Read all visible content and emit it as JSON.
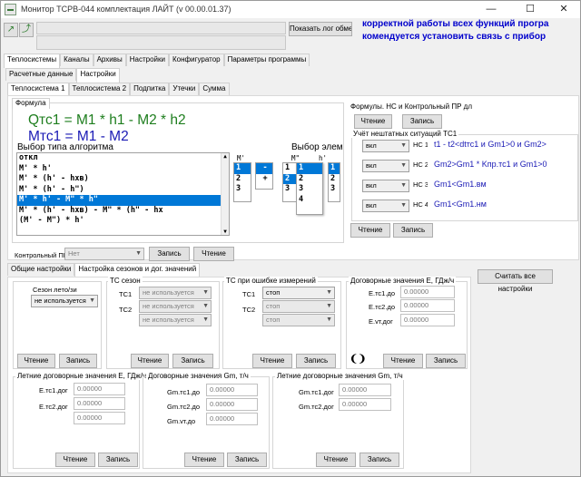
{
  "window": {
    "title": "Монитор ТСРВ-044 комплектация ЛАЙТ (v 00.00.01.37)",
    "minimize": "—",
    "maximize": "☐",
    "close": "✕"
  },
  "toolbar": {
    "show_log_label": "Показать лог обмена",
    "warning_line1": "корректной работы всех функций програ",
    "warning_line2": "комендуется установить связь с прибор"
  },
  "main_tabs": [
    "Теплосистемы",
    "Каналы",
    "Архивы",
    "Настройки",
    "Конфигуратор",
    "Параметры программы"
  ],
  "sub_tabs": [
    "Расчетные данные",
    "Настройки"
  ],
  "system_tabs": [
    "Теплосистема 1",
    "Теплосистема 2",
    "Подпитка",
    "Утечки",
    "Сумма"
  ],
  "formula": {
    "group_label": "Формула",
    "q_formula": "Qтс1 = M1 * h1 - M2 * h2",
    "m_formula": "Мтс1 = M1 - M2",
    "algo_label": "Выбор типа алгоритма",
    "algo_items": [
      "откл",
      "M' * h'",
      "M' * (h' - hхв)",
      "M' * (h' - h\")",
      "M' * h' - M\" * h\"",
      "M' * (h' - hхв) - M\" * (h\" - hх",
      "(M' - M\") * h'"
    ],
    "algo_selected": 4,
    "m1_label": "M'",
    "m2_label": "M\"",
    "h1_label": "h'",
    "elem_label": "Выбор элем",
    "list_m1": [
      "1",
      "2",
      "3"
    ],
    "ops": [
      "-",
      "+"
    ],
    "list_h": [
      "1",
      "2",
      "3"
    ],
    "dropdown": [
      "1",
      "2",
      "3",
      "4"
    ]
  },
  "nc": {
    "group_label": "Формулы. НС и Контрольный ПР дл",
    "read_label": "Чтение",
    "write_label": "Запись",
    "sub_label": "Учёт нештатных ситуаций ТС1",
    "rows": [
      {
        "mode": "вкл",
        "name": "НС 1",
        "cond": "t1 - t2<dtтс1 и Gm1>0 и Gm2>"
      },
      {
        "mode": "вкл",
        "name": "НС 2",
        "cond": "Gm2>Gm1 * Kпр.тс1 и Gm1>0"
      },
      {
        "mode": "вкл",
        "name": "НС 3",
        "cond": "Gm1<Gm1.вм"
      },
      {
        "mode": "вкл",
        "name": "НС 4",
        "cond": "Gm1<Gm1.нм"
      }
    ],
    "read2_label": "Чтение",
    "write2_label": "Запись"
  },
  "control": {
    "label": "Контрольный ПР",
    "value": "Нет",
    "write_label": "Запись",
    "read_label": "Чтение"
  },
  "settings_tabs": [
    "Общие настройки",
    "Настройка сезонов и дог. значений"
  ],
  "read_all_label": "Считать все настройки",
  "season": {
    "label": "Сезон лето/зи",
    "value": "не используется",
    "read_label": "Чтение",
    "write_label": "Запись"
  },
  "tc_season": {
    "label": "ТС сезон",
    "rows": [
      {
        "name": "ТС1",
        "value": "не используется"
      },
      {
        "name": "ТС2",
        "value": "не используется"
      },
      {
        "name": "",
        "value": "не используется"
      }
    ],
    "read_label": "Чтение",
    "write_label": "Запись"
  },
  "tc_error": {
    "label": "ТС при ошибке измерений",
    "rows": [
      {
        "name": "ТС1",
        "value": "стоп"
      },
      {
        "name": "ТС2",
        "value": "стоп"
      },
      {
        "name": "",
        "value": "стоп"
      }
    ],
    "read_label": "Чтение",
    "write_label": "Запись"
  },
  "contract_e": {
    "label": "Договорные значения Е, ГДж/ч",
    "rows": [
      {
        "name": "Е.тс1.до",
        "value": "0.00000"
      },
      {
        "name": "Е.тс2.до",
        "value": "0.00000"
      },
      {
        "name": "Е.vт.дог",
        "value": "0.00000"
      }
    ],
    "read_label": "Чтение",
    "write_label": "Запись"
  },
  "summer_e": {
    "label": "Летние договорные значения Е, ГДж/ч",
    "rows": [
      {
        "name": "Е.тс1.дог",
        "value": "0.00000"
      },
      {
        "name": "Е.тс2.дог",
        "value": "0.00000"
      },
      {
        "name": "",
        "value": "0.00000"
      }
    ],
    "read_label": "Чтение",
    "write_label": "Запись"
  },
  "contract_gm": {
    "label": "Договорные значения Gm, т/ч",
    "rows": [
      {
        "name": "Gm.тс1.до",
        "value": "0.00000"
      },
      {
        "name": "Gm.тс2.до",
        "value": "0.00000"
      },
      {
        "name": "Gm.vт.до",
        "value": "0.00000"
      }
    ],
    "read_label": "Чтение",
    "write_label": "Запись"
  },
  "summer_gm": {
    "label": "Летние договорные значения Gm, т/ч",
    "rows": [
      {
        "name": "Gm.тс1.дог",
        "value": "0.00000"
      },
      {
        "name": "Gm.тс2.дог",
        "value": "0.00000"
      }
    ],
    "read_label": "Чтение",
    "write_label": "Запись"
  },
  "colors": {
    "accent": "#0078d7",
    "warning": "#0000cc",
    "formula_q": "#1e7e1e",
    "formula_m": "#1a1ab5"
  }
}
